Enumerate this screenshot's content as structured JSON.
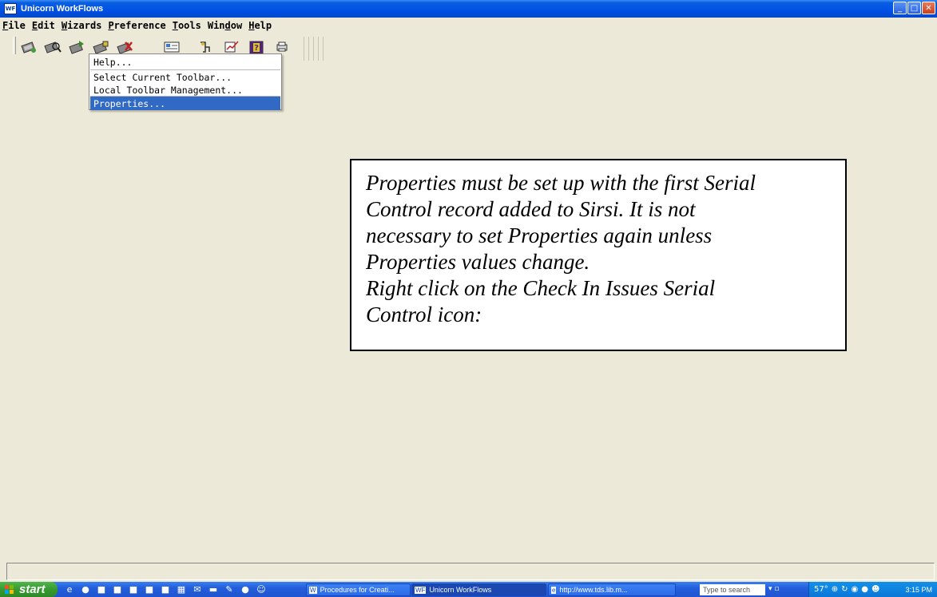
{
  "window": {
    "title": "Unicorn WorkFlows",
    "app_icon_text": "WF"
  },
  "menubar": [
    {
      "label": "File",
      "key": "F",
      "rest": "ile"
    },
    {
      "label": "Edit",
      "key": "E",
      "rest": "dit"
    },
    {
      "label": "Wizards",
      "key": "W",
      "rest": "izards"
    },
    {
      "label": "Preference",
      "key": "P",
      "rest": "reference"
    },
    {
      "label": "Tools",
      "key": "T",
      "rest": "ools"
    },
    {
      "label": "Window",
      "key": "d",
      "pre": "Win",
      "rest": "ow"
    },
    {
      "label": "Help",
      "key": "H",
      "rest": "elp"
    }
  ],
  "toolbar_icons": [
    "checkin-serial-icon",
    "search-serial-icon",
    "receive-issue-icon",
    "predict-issue-icon",
    "remove-serial-icon",
    "display-record-icon",
    "claim-icon",
    "route-icon",
    "help-icon",
    "print-icon"
  ],
  "context_menu": {
    "items": [
      "Help...",
      "Select Current Toolbar...",
      "Local Toolbar Management...",
      "Properties..."
    ],
    "selected": "Properties..."
  },
  "note": {
    "lines": [
      "Properties must be set up with the first Serial",
      "Control record added to Sirsi. It is not",
      "necessary to set Properties again unless",
      "Properties values change.",
      "Right click on the Check In Issues Serial",
      "Control icon:"
    ]
  },
  "taskbar": {
    "start_label": "start",
    "buttons": [
      "Procedures for Creati...",
      "Unicorn WorkFlows",
      "http://www.tds.lib.m..."
    ],
    "search_placeholder": "Type to search",
    "temperature": "57°",
    "clock": "3:15 PM"
  },
  "colors": {
    "titlebar": "#0050E6",
    "selection": "#316AC5",
    "background": "#ECE9D8"
  }
}
